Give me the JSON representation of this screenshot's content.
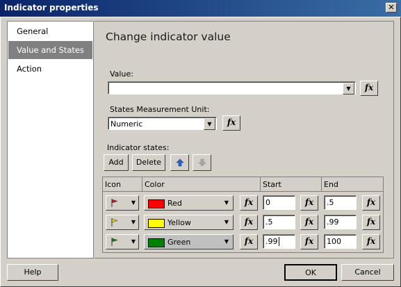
{
  "window": {
    "title": "Indicator properties",
    "close_glyph": "✕"
  },
  "nav": {
    "items": [
      {
        "label": "General"
      },
      {
        "label": "Value and States"
      },
      {
        "label": "Action"
      }
    ]
  },
  "main": {
    "heading": "Change indicator value",
    "value_label": "Value:",
    "value_field": "",
    "unit_label": "States Measurement Unit:",
    "unit_value": "Numeric",
    "states_label": "Indicator states:",
    "add_label": "Add",
    "delete_label": "Delete",
    "fx_label": "fx",
    "grid": {
      "headers": {
        "icon": "Icon",
        "color": "Color",
        "start": "Start",
        "end": "End"
      },
      "rows": [
        {
          "color_name": "Red",
          "color_hex": "#ff0000",
          "flag_hex": "#d01010",
          "start": "0",
          "end": ".5"
        },
        {
          "color_name": "Yellow",
          "color_hex": "#ffff00",
          "flag_hex": "#e0d000",
          "start": ".5",
          "end": ".99"
        },
        {
          "color_name": "Green",
          "color_hex": "#008000",
          "flag_hex": "#108010",
          "start": ".99",
          "end": "100"
        }
      ]
    }
  },
  "footer": {
    "help_label": "Help",
    "ok_label": "OK",
    "cancel_label": "Cancel"
  }
}
